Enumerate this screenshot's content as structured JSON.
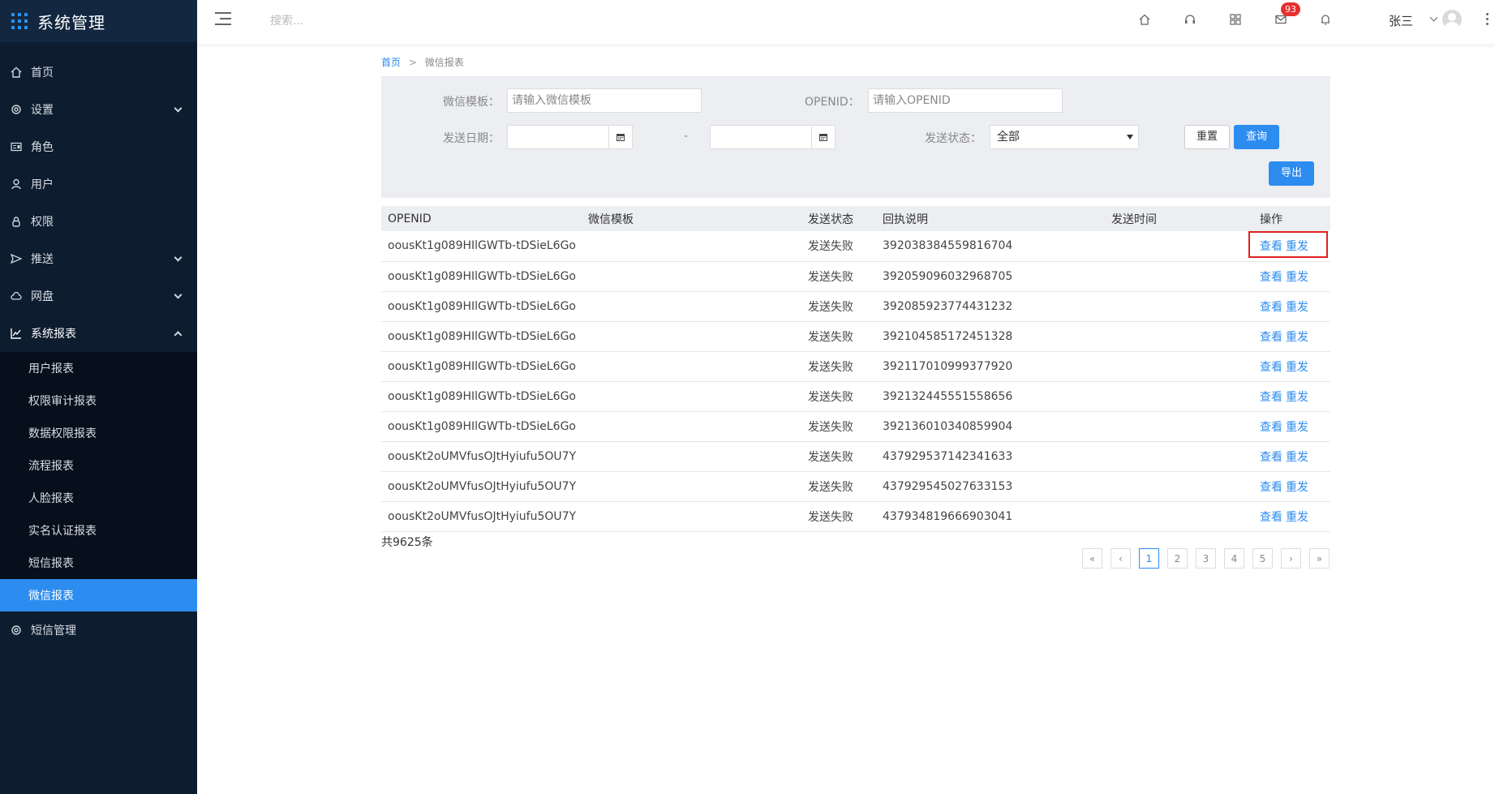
{
  "app": {
    "title": "系统管理"
  },
  "sidebar": {
    "items": [
      {
        "label": "首页",
        "icon": "home-icon"
      },
      {
        "label": "设置",
        "icon": "gear-icon"
      },
      {
        "label": "角色",
        "icon": "id-card-icon"
      },
      {
        "label": "用户",
        "icon": "user-icon"
      },
      {
        "label": "权限",
        "icon": "lock-icon"
      },
      {
        "label": "推送",
        "icon": "send-icon"
      },
      {
        "label": "网盘",
        "icon": "cloud-icon"
      },
      {
        "label": "系统报表",
        "icon": "chart-icon"
      },
      {
        "label": "短信管理",
        "icon": "gear-icon"
      }
    ],
    "report_sub": [
      "用户报表",
      "权限审计报表",
      "数据权限报表",
      "流程报表",
      "人脸报表",
      "实名认证报表",
      "短信报表",
      "微信报表"
    ]
  },
  "header": {
    "search_placeholder": "搜索...",
    "mail_badge": "93",
    "user_name": "张三"
  },
  "breadcrumb": {
    "home": "首页",
    "sep": ">",
    "current": "微信报表"
  },
  "filter": {
    "template_label": "微信模板：",
    "template_placeholder": "请输入微信模板",
    "openid_label": "OPENID：",
    "openid_placeholder": "请输入OPENID",
    "date_label": "发送日期：",
    "date_sep": "-",
    "status_label": "发送状态：",
    "status_value": "全部",
    "reset_label": "重置",
    "query_label": "查询",
    "export_label": "导出"
  },
  "table": {
    "columns": [
      "OPENID",
      "微信模板",
      "发送状态",
      "回执说明",
      "发送时间",
      "操作"
    ],
    "view_label": "查看",
    "resend_label": "重发",
    "rows": [
      {
        "openid": "oousKt1g089HIlGWTb-tDSieL6Go",
        "template": "",
        "status": "发送失败",
        "receipt": "392038384559816704",
        "time": ""
      },
      {
        "openid": "oousKt1g089HIlGWTb-tDSieL6Go",
        "template": "",
        "status": "发送失败",
        "receipt": "392059096032968705",
        "time": ""
      },
      {
        "openid": "oousKt1g089HIlGWTb-tDSieL6Go",
        "template": "",
        "status": "发送失败",
        "receipt": "392085923774431232",
        "time": ""
      },
      {
        "openid": "oousKt1g089HIlGWTb-tDSieL6Go",
        "template": "",
        "status": "发送失败",
        "receipt": "392104585172451328",
        "time": ""
      },
      {
        "openid": "oousKt1g089HIlGWTb-tDSieL6Go",
        "template": "",
        "status": "发送失败",
        "receipt": "392117010999377920",
        "time": ""
      },
      {
        "openid": "oousKt1g089HIlGWTb-tDSieL6Go",
        "template": "",
        "status": "发送失败",
        "receipt": "392132445551558656",
        "time": ""
      },
      {
        "openid": "oousKt1g089HIlGWTb-tDSieL6Go",
        "template": "",
        "status": "发送失败",
        "receipt": "392136010340859904",
        "time": ""
      },
      {
        "openid": "oousKt2oUMVfusOJtHyiufu5OU7Y",
        "template": "",
        "status": "发送失败",
        "receipt": "437929537142341633",
        "time": ""
      },
      {
        "openid": "oousKt2oUMVfusOJtHyiufu5OU7Y",
        "template": "",
        "status": "发送失败",
        "receipt": "437929545027633153",
        "time": ""
      },
      {
        "openid": "oousKt2oUMVfusOJtHyiufu5OU7Y",
        "template": "",
        "status": "发送失败",
        "receipt": "437934819666903041",
        "time": ""
      }
    ]
  },
  "footer": {
    "total": "共9625条",
    "pages": [
      "«",
      "‹",
      "1",
      "2",
      "3",
      "4",
      "5",
      "›",
      "»"
    ],
    "current_page": "1"
  },
  "colors": {
    "sidebar_bg": "#0e1c2f",
    "accent": "#2d8cf0",
    "badge": "#e62e2e",
    "highlight": "#e02020"
  }
}
